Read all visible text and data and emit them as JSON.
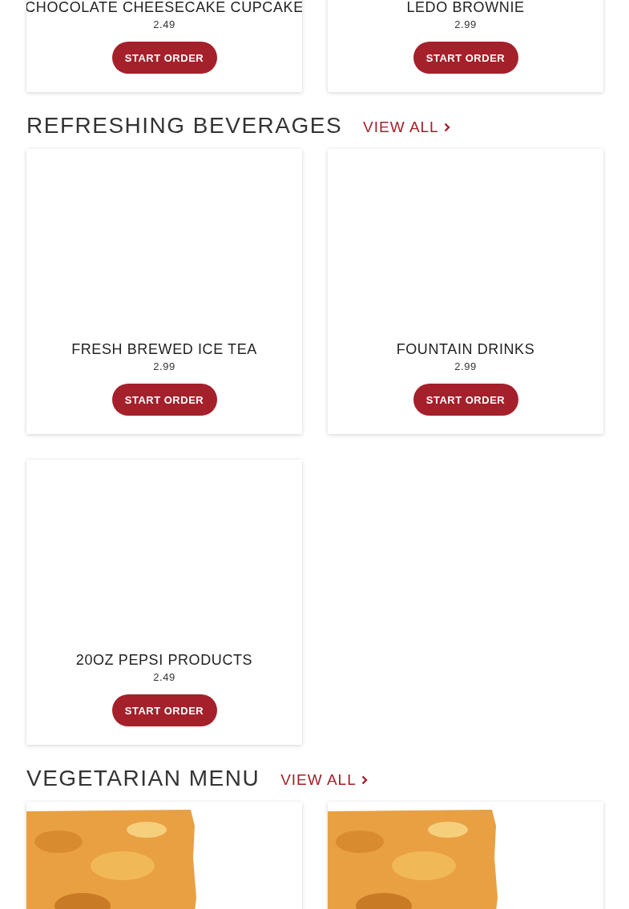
{
  "sections": [
    {
      "items": [
        {
          "name": "CHOCOLATE CHEESECAKE CUPCAKE",
          "price": "2.49",
          "button": "START ORDER"
        },
        {
          "name": "LEDO BROWNIE",
          "price": "2.99",
          "button": "START ORDER"
        }
      ]
    },
    {
      "title": "REFRESHING BEVERAGES",
      "view_all": "VIEW ALL",
      "items": [
        {
          "name": "FRESH BREWED ICE TEA",
          "price": "2.99",
          "button": "START ORDER"
        },
        {
          "name": "FOUNTAIN DRINKS",
          "price": "2.99",
          "button": "START ORDER"
        },
        {
          "name": "20OZ PEPSI PRODUCTS",
          "price": "2.49",
          "button": "START ORDER"
        }
      ]
    },
    {
      "title": "VEGETARIAN MENU",
      "view_all": "VIEW ALL"
    }
  ]
}
